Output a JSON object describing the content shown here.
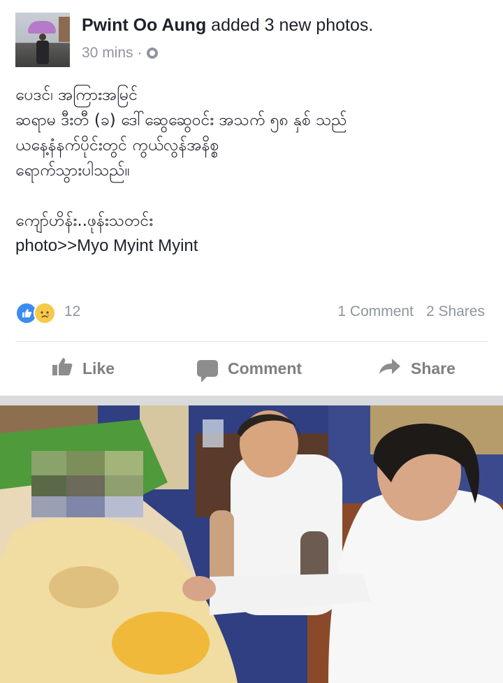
{
  "post": {
    "author": "Pwint Oo Aung",
    "action": "added 3 new photos.",
    "time": "30 mins",
    "separator": "·",
    "privacy_icon": "globe-icon",
    "text_lines": [
      "ပေဒင်၊ အကြားအမြင်",
      "ဆရာမ ဒီးတီ (ခ) ဒေါ်ဆွေဆွေဝင်း အသက် ၅၈ နှစ် သည်",
      "ယနေ့နံနက်ပိုင်းတွင် ကွယ်လွန်အနိစ္စ",
      "ရောက်သွားပါသည်။"
    ],
    "closing_line": "ကျော်ဟိန်း..ဖုန်းသတင်း",
    "photo_credit": "photo>>Myo Myint Myint"
  },
  "reactions": {
    "icons": [
      "like-icon",
      "sad-icon"
    ],
    "count": "12",
    "comments": "1 Comment",
    "shares": "2 Shares"
  },
  "actions": {
    "like": "Like",
    "comment": "Comment",
    "share": "Share"
  },
  "colors": {
    "like_blue": "#3b8cf0",
    "sad_yellow": "#f7c94a",
    "meta_gray": "#90949c",
    "action_gray": "#7f7f7f"
  }
}
